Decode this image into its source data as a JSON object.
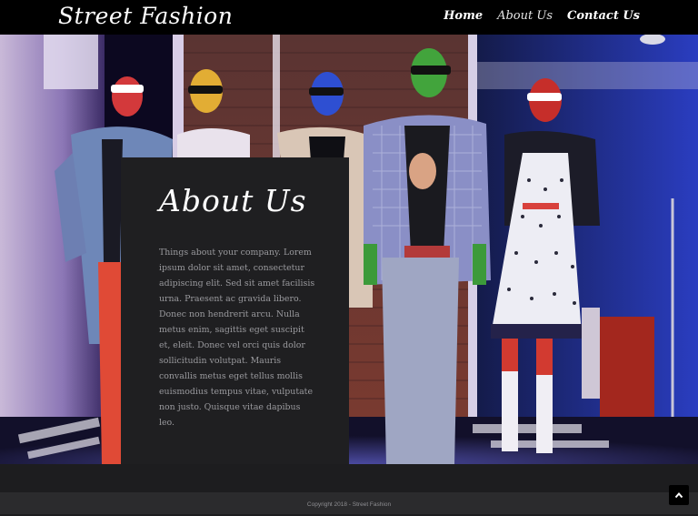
{
  "header": {
    "logo": "Street Fashion",
    "nav": [
      "Home",
      "About Us",
      "Contact Us"
    ],
    "active_nav": "About Us"
  },
  "about": {
    "title": "About Us",
    "body": "Things about your company. Lorem ipsum dolor sit amet, consectetur adipiscing elit. Sed sit amet facilisis urna. Praesent ac gravida libero. Donec non hendrerit arcu. Nulla metus enim, sagittis eget suscipit et, eleit. Donec vel orci quis dolor sollicitudin volutpat. Mauris convallis metus eget tellus mollis euismodius tempus vitae, vulputate non justo. Quisque vitae dapibus leo."
  },
  "footer": {
    "copyright": "Copyright 2018 - Street Fashion"
  },
  "icons": {
    "back_to_top": "chevron-up-icon"
  }
}
